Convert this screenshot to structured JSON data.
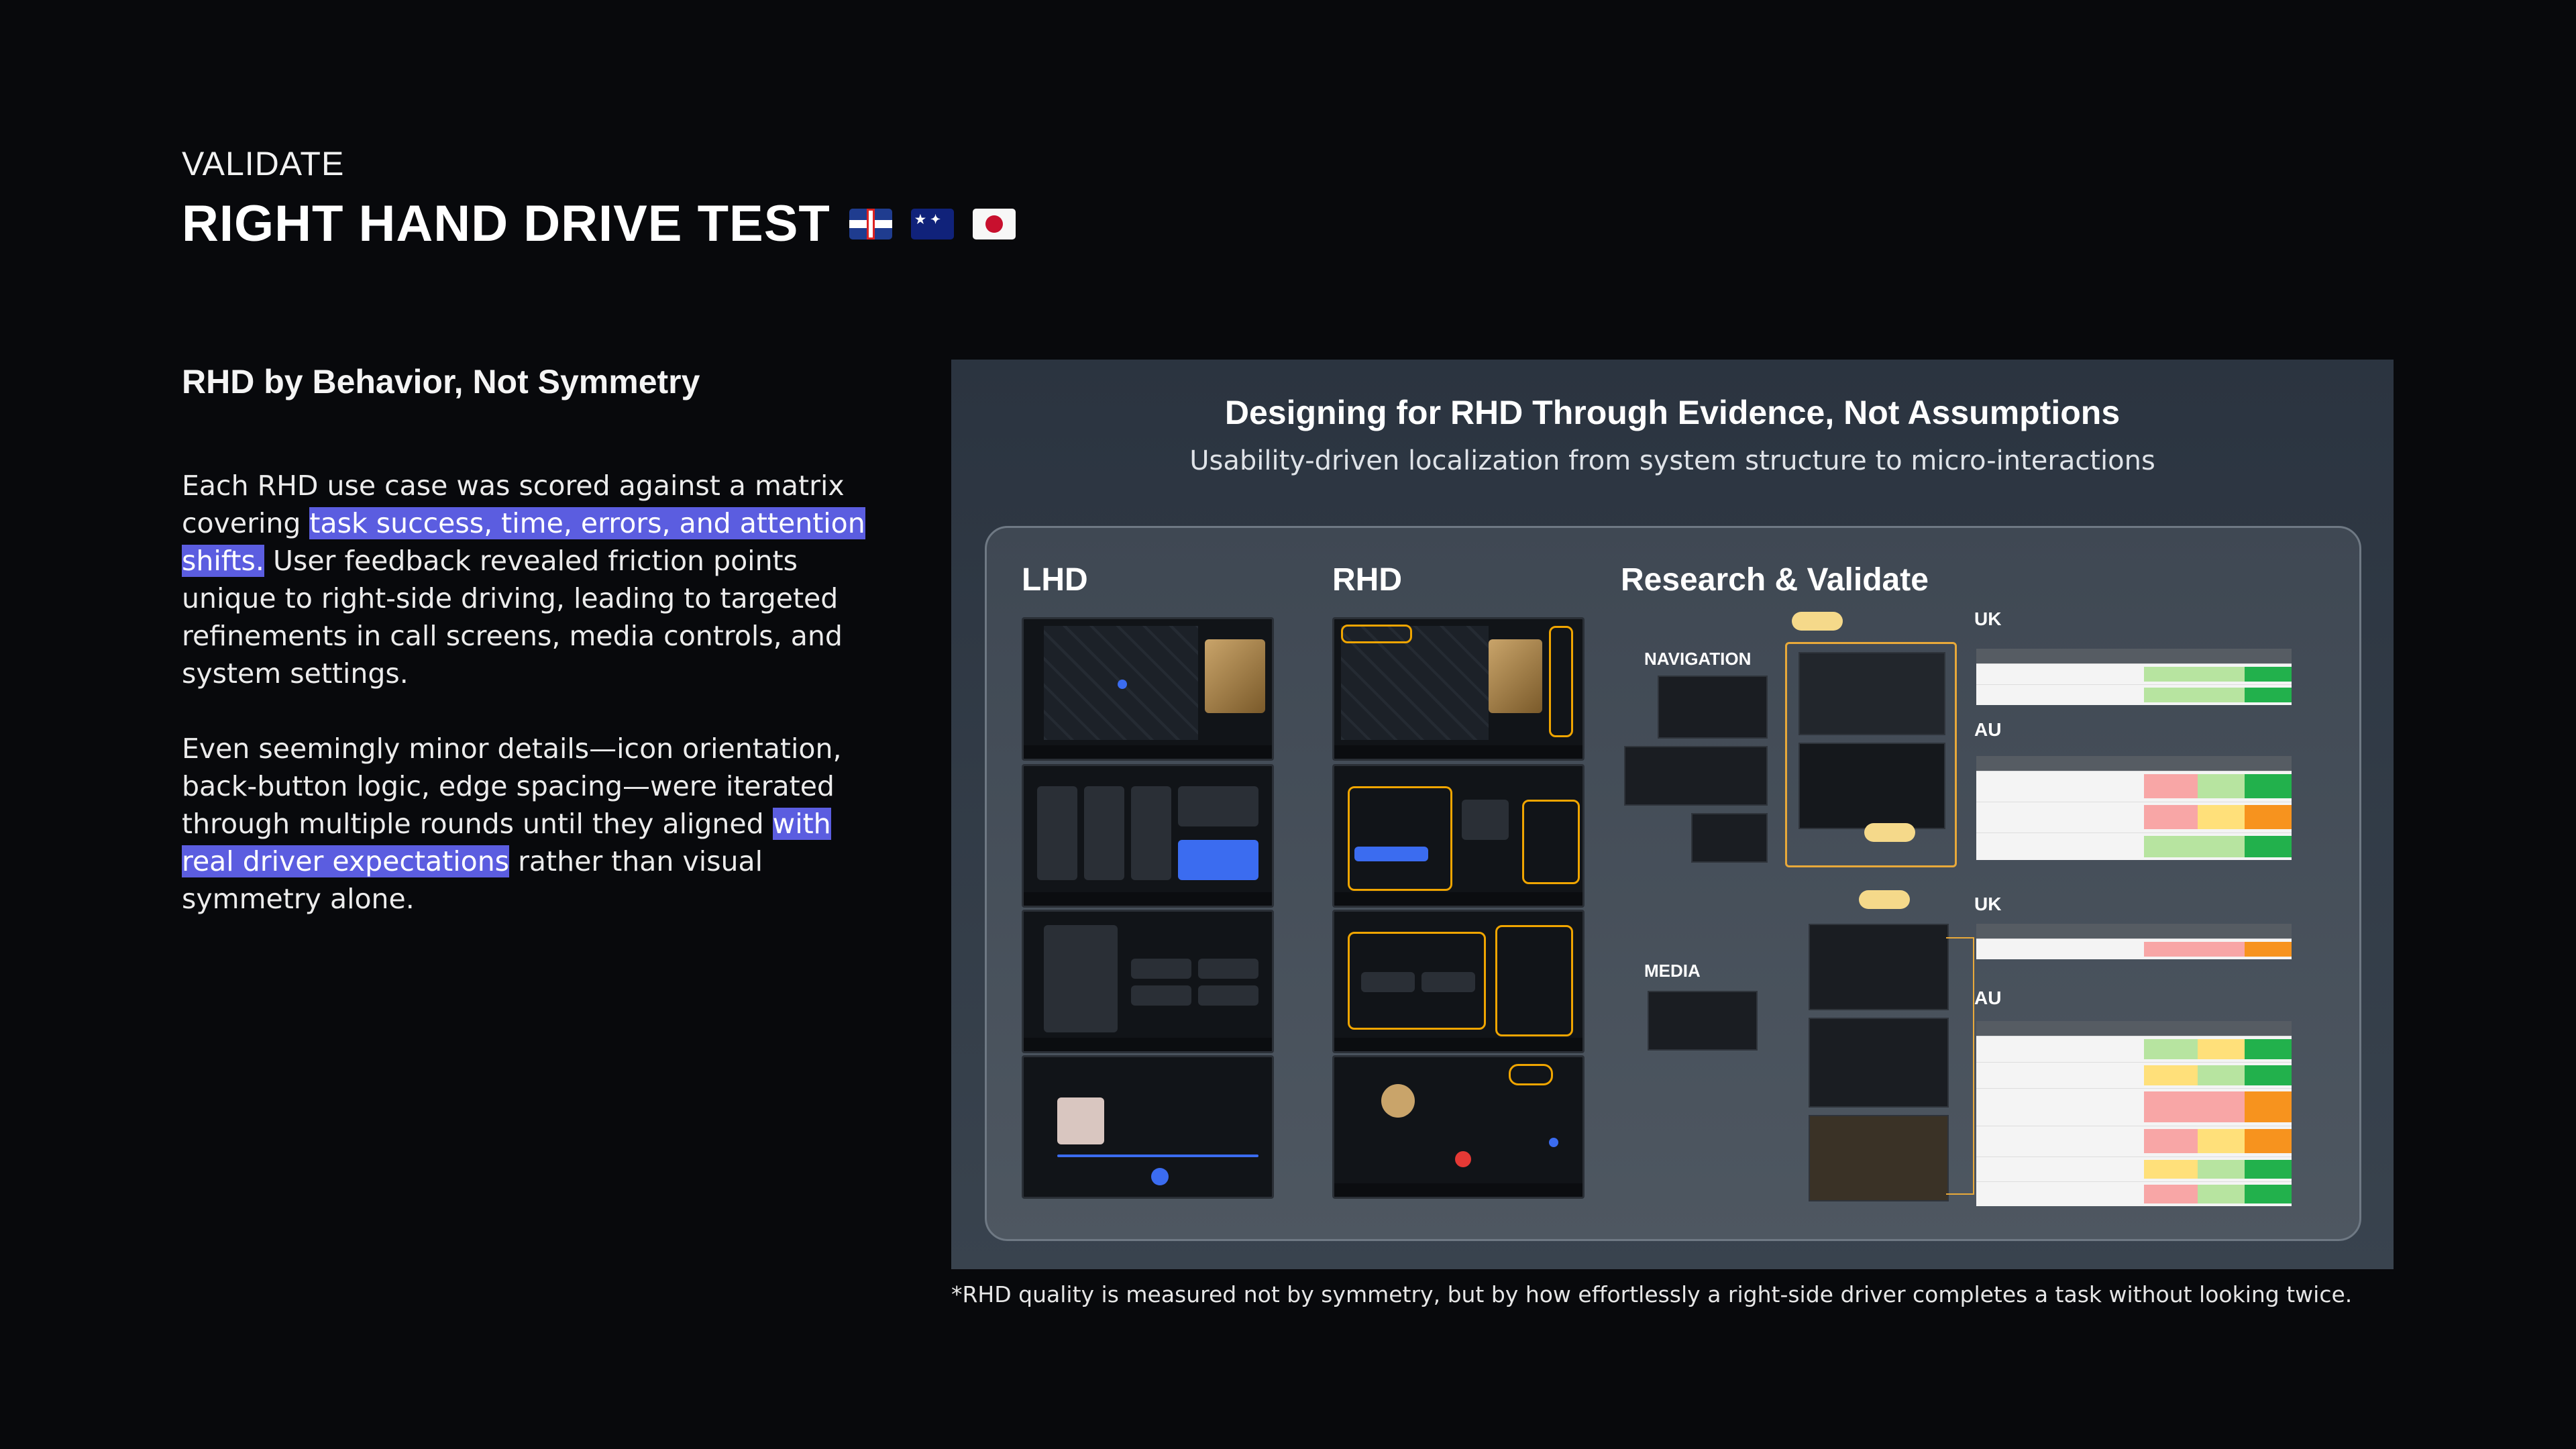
{
  "header": {
    "eyebrow": "VALIDATE",
    "title": "RIGHT HAND DRIVE TEST",
    "flags": [
      "uk-flag-icon",
      "australia-flag-icon",
      "japan-flag-icon"
    ]
  },
  "left": {
    "subhead": "RHD by Behavior, Not Symmetry",
    "p1_a": "Each RHD use case was scored against a matrix covering ",
    "p1_hl": "task success, time, errors, and attention shifts.",
    "p1_b": " User feedback revealed friction points unique to right-side driving, leading to targeted refinements in call screens, media controls, and system settings.",
    "p2_a": "Even seemingly minor details—icon orientation, back-button logic, edge spacing—were iterated through multiple rounds until they aligned ",
    "p2_hl": "with real driver expectations",
    "p2_b": " rather than visual symmetry alone."
  },
  "panel": {
    "title": "Designing for RHD Through Evidence, Not Assumptions",
    "subtitle": "Usability-driven localization from system structure to micro-interactions",
    "col_lhd": "LHD",
    "col_rhd": "RHD",
    "col_research": "Research & Validate",
    "navigation_label": "NAVIGATION",
    "media_label": "MEDIA",
    "regions": {
      "nav_uk": "UK",
      "nav_au": "AU",
      "media_uk": "UK",
      "media_au": "AU"
    }
  },
  "footnote": "*RHD quality is measured not by symmetry, but by how effortlessly a right-side driver completes a task without looking twice.",
  "colors": {
    "background": "#08090c",
    "highlight": "#5b5de0",
    "accent_gold": "#e9a93a",
    "good": "#22b14c",
    "warn": "#f7931e"
  }
}
